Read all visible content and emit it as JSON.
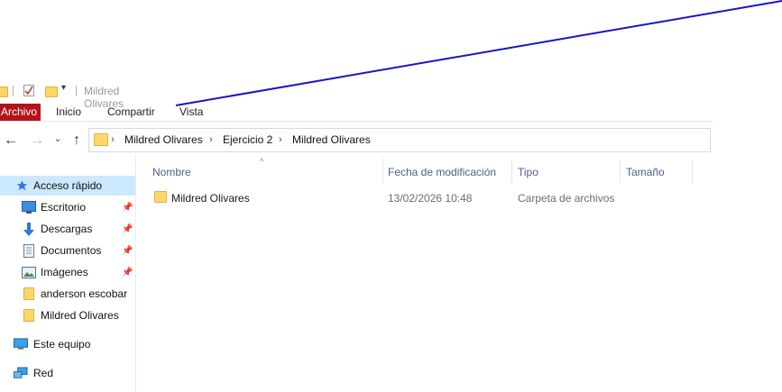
{
  "title_bar": {
    "title": "Mildred Olivares",
    "dropdown_glyph": "▾"
  },
  "ribbon": {
    "tabs": [
      "Archivo",
      "Inicio",
      "Compartir",
      "Vista"
    ]
  },
  "navigation": {
    "back_glyph": "←",
    "forward_glyph": "→",
    "history_glyph": "⌄",
    "up_glyph": "↑"
  },
  "address_bar": {
    "separator": "›",
    "breadcrumbs": [
      "Mildred Olivares",
      "Ejercicio 2",
      "Mildred Olivares"
    ]
  },
  "sidebar": {
    "pin_glyph": "📌",
    "items": [
      {
        "label": "Acceso rápido",
        "icon": "star-icon"
      },
      {
        "label": "Escritorio",
        "icon": "desktop-icon"
      },
      {
        "label": "Descargas",
        "icon": "download-icon"
      },
      {
        "label": "Documentos",
        "icon": "document-icon"
      },
      {
        "label": "Imágenes",
        "icon": "pictures-icon"
      },
      {
        "label": "anderson escobar",
        "icon": "folder-icon"
      },
      {
        "label": "Mildred Olivares",
        "icon": "folder-icon"
      },
      {
        "label": "Este equipo",
        "icon": "computer-icon"
      },
      {
        "label": "Red",
        "icon": "network-icon"
      }
    ]
  },
  "columns": [
    "Nombre",
    "Fecha de modificación",
    "Tipo",
    "Tamaño"
  ],
  "sort_glyph": "^",
  "files": [
    {
      "name": "Mildred Olivares",
      "modified": "13/02/2026 10:48",
      "type": "Carpeta de archivos",
      "size": ""
    }
  ],
  "colors": {
    "archivo_tab": "#b3141c",
    "selection": "#cce8ff",
    "annotation_line": "#1515c8",
    "folder": "#ffd766"
  }
}
